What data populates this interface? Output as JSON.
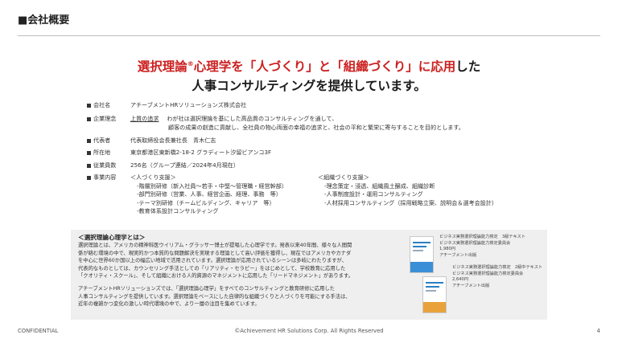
{
  "header": {
    "title": "■会社概要"
  },
  "headline": {
    "line1_red_a": "選択理論",
    "line1_mark": "®",
    "line1_red_b": "心理学を「人づくり」と「組織づくり」に応用",
    "line1_black": "した",
    "line2": "人事コンサルティングを提供しています。"
  },
  "info": {
    "company": {
      "label": "会社名",
      "value": "アチーブメントHRソリューションズ株式会社"
    },
    "philosophy": {
      "label": "企業理念",
      "keyword": "上質の追求",
      "line1": "わが社は選択理論を基にした高品質のコンサルティングを通して、",
      "line2": "顧客の成果の創造に貢献し、全社員の物心両面の幸福の追求と、社会の平和と繁栄に寄与することを目的とします。"
    },
    "ceo": {
      "label": "代表者",
      "value": "代表取締役会長兼社長　青木仁志"
    },
    "address": {
      "label": "所在地",
      "value": "東京都港区東新橋2-18-2 グラディート汐留ビアンコ3F"
    },
    "employees": {
      "label": "従業員数",
      "value": "256名（グループ連結／2024年4月現在）"
    },
    "business": {
      "label": "事業内容",
      "left": [
        "＜人づくり支援＞",
        "-階層別研修（新入社員～若手・中堅～管理職・経営幹部）",
        "-部門別研修（営業、人事、経営企画、経理、事務　等）",
        "-テーマ別研修（チームビルディング、キャリア　等）",
        "-教育体系設計コンサルティング"
      ],
      "right": [
        "＜組織づくり支援＞",
        "-理念策定・浸透、組織風土醸成、組織診断",
        "-人事制度設計・運用コンサルティング",
        "-人材採用コンサルティング（採用戦略立案、説明会＆選考会設計）"
      ]
    }
  },
  "box": {
    "title": "＜選択理論心理学とは＞",
    "para1": [
      "選択理論とは、アメリカの精神科医ウイリアム・グラッサー博士が提唱した心理学です。発表以来40年間、様々な人間関",
      "係が絡む環境の中で、現実的かつ本質的な問題解決を実現する理論として高い評価を獲得し、現在ではアメリカやカナダ",
      "を中心に世界60か国以上の幅広い地域で活用されています。選択理論が応用されているシーンは多岐にわたりますが、",
      "代表的なものとしては、カウンセリング手法としての「リアリティ・セラピー」をはじめとして、学校教育に応用した",
      "「クオリティ・スクール」、そして組織における人的資源のマネジメントに応用した「リードマネジメント」があります。"
    ],
    "para2": [
      "アチーブメントHRソリューションズでは、「選択理論心理学」をすべてのコンサルティングと教育研修に応用した",
      "人事コンサルティングを提供しています。選択理論をベースにした自律的な組織づくりと人づくりを可能にする手法は、",
      "近年の複雑かつ変化の激しい時代環境の中で、より一層の注目を集めています。"
    ],
    "books": [
      {
        "lines": [
          "ビジネス実務選択理論能力検定　3級テキスト",
          "ビジネス実務選択理論能力検定委員会",
          "1,980円",
          "アチーブメント出版"
        ],
        "band": "#3a8fd6"
      },
      {
        "lines": [
          "ビジネス実務選択理論能力検定　2級中テキスト",
          "ビジネス実務選択理論能力検定委員会",
          "2,640円",
          "アチーブメント出版"
        ],
        "band": "#e9a23b"
      }
    ]
  },
  "footer": {
    "left": "CONFIDENTIAL",
    "center": "©Achievement HR Solutions Corp. All Rights Reserved",
    "page": "4"
  }
}
